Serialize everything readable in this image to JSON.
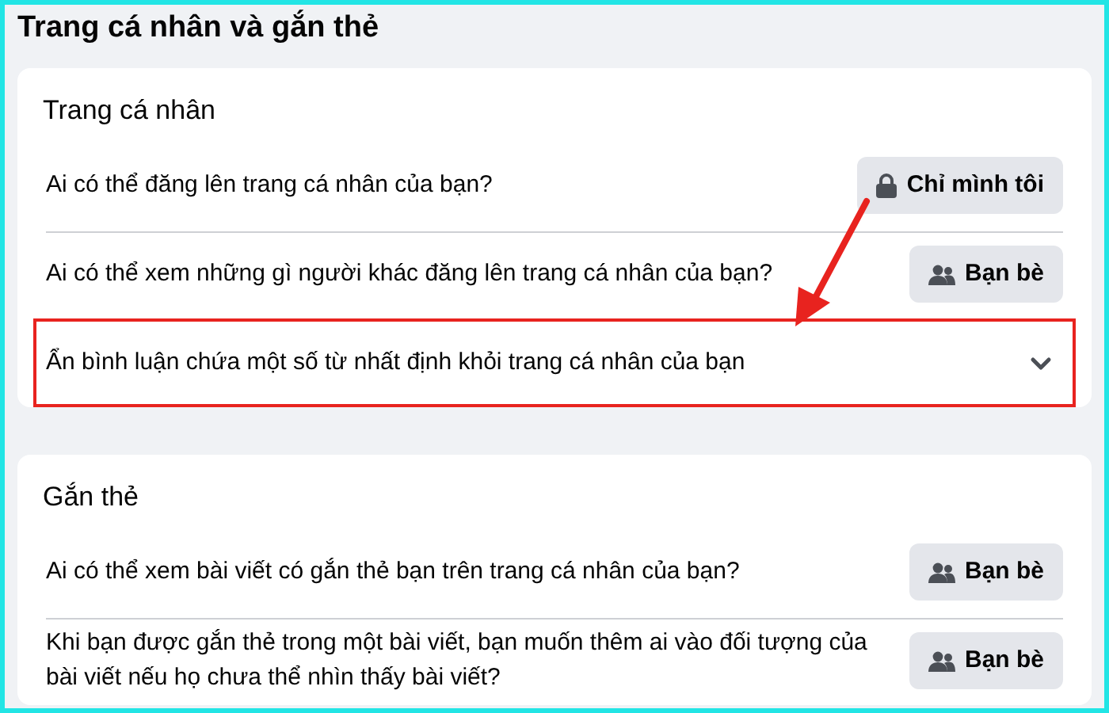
{
  "page_title": "Trang cá nhân và gắn thẻ",
  "sections": [
    {
      "title": "Trang cá nhân",
      "rows": [
        {
          "kind": "button",
          "label": "Ai có thể đăng lên trang cá nhân của bạn?",
          "private": true,
          "button": "Chỉ mình tôi",
          "highlighted": false
        },
        {
          "kind": "button",
          "label": "Ai có thể xem những gì người khác đăng lên trang cá nhân của bạn?",
          "private": false,
          "button": "Bạn bè",
          "highlighted": false
        },
        {
          "kind": "expand",
          "label": "Ẩn bình luận chứa một số từ nhất định khỏi trang cá nhân của bạn",
          "expanded": false,
          "highlighted": true
        }
      ]
    },
    {
      "title": "Gắn thẻ",
      "rows": [
        {
          "kind": "button",
          "label": "Ai có thể xem bài viết có gắn thẻ bạn trên trang cá nhân của bạn?",
          "private": false,
          "button": "Bạn bè",
          "highlighted": false
        },
        {
          "kind": "button",
          "label": "Khi bạn được gắn thẻ trong một bài viết, bạn muốn thêm ai vào đối tượng của bài viết nếu họ chưa thể nhìn thấy bài viết?",
          "private": false,
          "button": "Bạn bè",
          "highlighted": false
        }
      ]
    }
  ]
}
